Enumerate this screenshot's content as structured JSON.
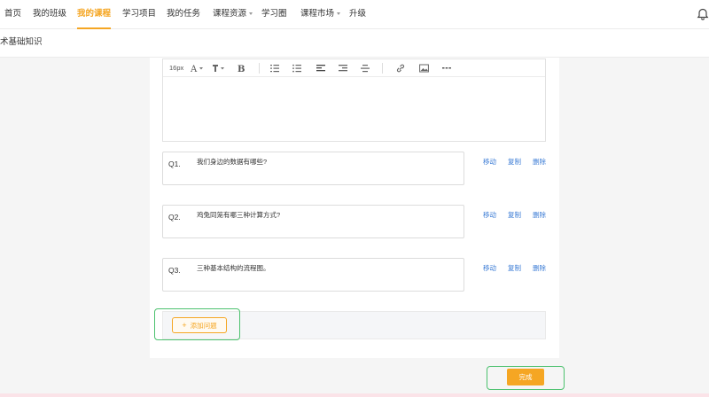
{
  "nav": {
    "items": [
      {
        "label": "首页"
      },
      {
        "label": "我的班级"
      },
      {
        "label": "我的课程"
      },
      {
        "label": "学习项目"
      },
      {
        "label": "我的任务"
      },
      {
        "label": "课程资源"
      },
      {
        "label": "学习圈"
      },
      {
        "label": "课程市场"
      },
      {
        "label": "升级"
      }
    ],
    "active": "我的课程",
    "bell_icon": "bell-icon"
  },
  "subbar": {
    "title": "术基础知识"
  },
  "editor": {
    "font_size": "16px",
    "icons": [
      "font-color-icon",
      "highlight-icon",
      "bold-icon",
      "ordered-list-icon",
      "unordered-list-icon",
      "align-left-icon",
      "align-right-icon",
      "strikethrough-icon",
      "link-icon",
      "image-icon",
      "horizontal-rule-icon"
    ]
  },
  "questions": [
    {
      "num": "Q1.",
      "text": "我们身边的数据有哪些?",
      "move": "移动",
      "copy": "复制",
      "delete": "删除"
    },
    {
      "num": "Q2.",
      "text": "鸡兔同笼有哪三种计算方式?",
      "move": "移动",
      "copy": "复制",
      "delete": "删除"
    },
    {
      "num": "Q3.",
      "text": "三种基本结构的流程图。",
      "move": "移动",
      "copy": "复制",
      "delete": "删除"
    }
  ],
  "add_question": {
    "label": "添加问题"
  },
  "done": {
    "label": "完成"
  },
  "colors": {
    "accent": "#f5a623",
    "link": "#3a7bd5",
    "highlight": "#4cc16e"
  }
}
